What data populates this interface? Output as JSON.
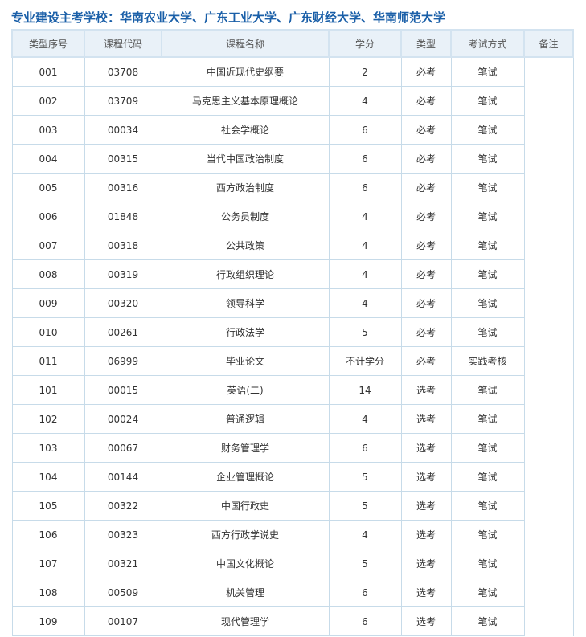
{
  "title": "专业建设主考学校：华南农业大学、广东工业大学、广东财经大学、华南师范大学",
  "table": {
    "headers": [
      "类型序号",
      "课程代码",
      "课程名称",
      "学分",
      "类型",
      "考试方式",
      "备注"
    ],
    "rows": [
      [
        "001",
        "03708",
        "中国近现代史纲要",
        "2",
        "必考",
        "笔试"
      ],
      [
        "002",
        "03709",
        "马克思主义基本原理概论",
        "4",
        "必考",
        "笔试"
      ],
      [
        "003",
        "00034",
        "社会学概论",
        "6",
        "必考",
        "笔试"
      ],
      [
        "004",
        "00315",
        "当代中国政治制度",
        "6",
        "必考",
        "笔试"
      ],
      [
        "005",
        "00316",
        "西方政治制度",
        "6",
        "必考",
        "笔试"
      ],
      [
        "006",
        "01848",
        "公务员制度",
        "4",
        "必考",
        "笔试"
      ],
      [
        "007",
        "00318",
        "公共政策",
        "4",
        "必考",
        "笔试"
      ],
      [
        "008",
        "00319",
        "行政组织理论",
        "4",
        "必考",
        "笔试"
      ],
      [
        "009",
        "00320",
        "领导科学",
        "4",
        "必考",
        "笔试"
      ],
      [
        "010",
        "00261",
        "行政法学",
        "5",
        "必考",
        "笔试"
      ],
      [
        "011",
        "06999",
        "毕业论文",
        "不计学分",
        "必考",
        "实践考核"
      ],
      [
        "101",
        "00015",
        "英语(二)",
        "14",
        "选考",
        "笔试"
      ],
      [
        "102",
        "00024",
        "普通逻辑",
        "4",
        "选考",
        "笔试"
      ],
      [
        "103",
        "00067",
        "财务管理学",
        "6",
        "选考",
        "笔试"
      ],
      [
        "104",
        "00144",
        "企业管理概论",
        "5",
        "选考",
        "笔试"
      ],
      [
        "105",
        "00322",
        "中国行政史",
        "5",
        "选考",
        "笔试"
      ],
      [
        "106",
        "00323",
        "西方行政学说史",
        "4",
        "选考",
        "笔试"
      ],
      [
        "107",
        "00321",
        "中国文化概论",
        "5",
        "选考",
        "笔试"
      ],
      [
        "108",
        "00509",
        "机关管理",
        "6",
        "选考",
        "笔试"
      ],
      [
        "109",
        "00107",
        "现代管理学",
        "6",
        "选考",
        "笔试"
      ]
    ]
  }
}
